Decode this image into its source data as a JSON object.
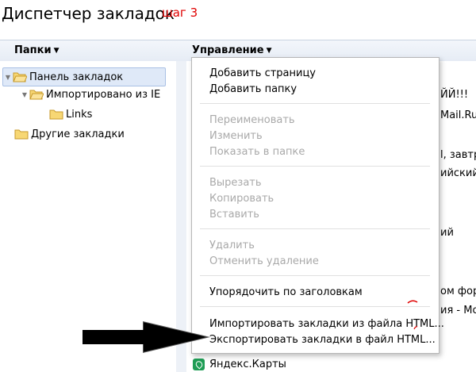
{
  "window": {
    "title": "Диспетчер закладок",
    "step_label": "шаг 3",
    "step_color": "#e00000"
  },
  "header": {
    "folders_label": "Папки",
    "manage_label": "Управление"
  },
  "tree": [
    {
      "label": "Панель закладок",
      "expanded": true,
      "selected": true
    },
    {
      "label": "Импортировано из IE",
      "expanded": true,
      "selected": false
    },
    {
      "label": "Links",
      "expanded": false,
      "selected": false
    },
    {
      "label": "Другие закладки",
      "expanded": false,
      "selected": false
    }
  ],
  "background_list": [
    "ЙЙ!!!",
    "Mail.Ru",
    "l, завтра",
    "ийский",
    "ий",
    "ом фору",
    "ия - Мой"
  ],
  "yandex_item": "Яндекс.Карты",
  "menu": {
    "groups": [
      [
        {
          "label": "Добавить страницу",
          "enabled": true
        },
        {
          "label": "Добавить папку",
          "enabled": true
        }
      ],
      [
        {
          "label": "Переименовать",
          "enabled": false
        },
        {
          "label": "Изменить",
          "enabled": false
        },
        {
          "label": "Показать в папке",
          "enabled": false
        }
      ],
      [
        {
          "label": "Вырезать",
          "enabled": false
        },
        {
          "label": "Копировать",
          "enabled": false
        },
        {
          "label": "Вставить",
          "enabled": false
        }
      ],
      [
        {
          "label": "Удалить",
          "enabled": false
        },
        {
          "label": "Отменить удаление",
          "enabled": false
        }
      ],
      [
        {
          "label": "Упорядочить по заголовкам",
          "enabled": true
        }
      ],
      [
        {
          "label": "Импортировать закладки из файла HTML...",
          "enabled": true
        },
        {
          "label": "Экспортировать закладки в файл HTML...",
          "enabled": true
        }
      ]
    ]
  },
  "colors": {
    "folder_fill": "#f7d774",
    "folder_stroke": "#c79a2b",
    "selected_bg": "#dfe9f8",
    "arrow": "#000000"
  }
}
